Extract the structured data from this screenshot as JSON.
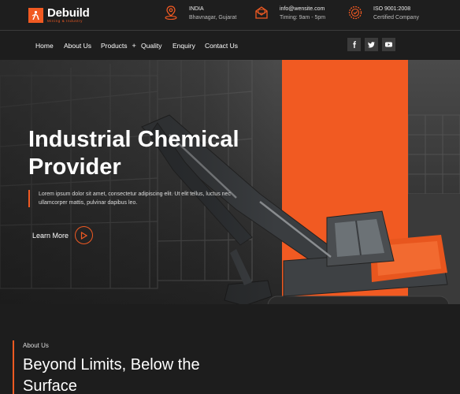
{
  "brand": {
    "name": "Debuild",
    "tagline": "Mining & Industry"
  },
  "contact_info": [
    {
      "icon": "location-icon",
      "line1": "INDIA",
      "line2": "Bhavnagar, Gujarat"
    },
    {
      "icon": "mail-icon",
      "line1": "info@wensite.com",
      "line2": "Timing: 9am - 5pm"
    },
    {
      "icon": "certificate-icon",
      "line1": "ISO 9001:2008",
      "line2": "Certified Company"
    }
  ],
  "nav": {
    "items": [
      "Home",
      "About Us",
      "Products",
      "Quality",
      "Enquiry",
      "Contact Us"
    ],
    "products_plus": "+"
  },
  "social": [
    "facebook-icon",
    "twitter-icon",
    "youtube-icon"
  ],
  "hero": {
    "title_line1": "Industrial Chemical",
    "title_line2": "Provider",
    "description": "Lorem ipsum dolor sit amet, consectetur adipiscing elit. Ut elit tellus, luctus nec ullamcorper mattis, pulvinar dapibus leo.",
    "cta_label": "Learn More"
  },
  "about": {
    "label": "About Us",
    "title_line1": "Beyond Limits, Below the",
    "title_line2": "Surface"
  },
  "colors": {
    "accent": "#f15a22",
    "background": "#1d1d1d"
  }
}
